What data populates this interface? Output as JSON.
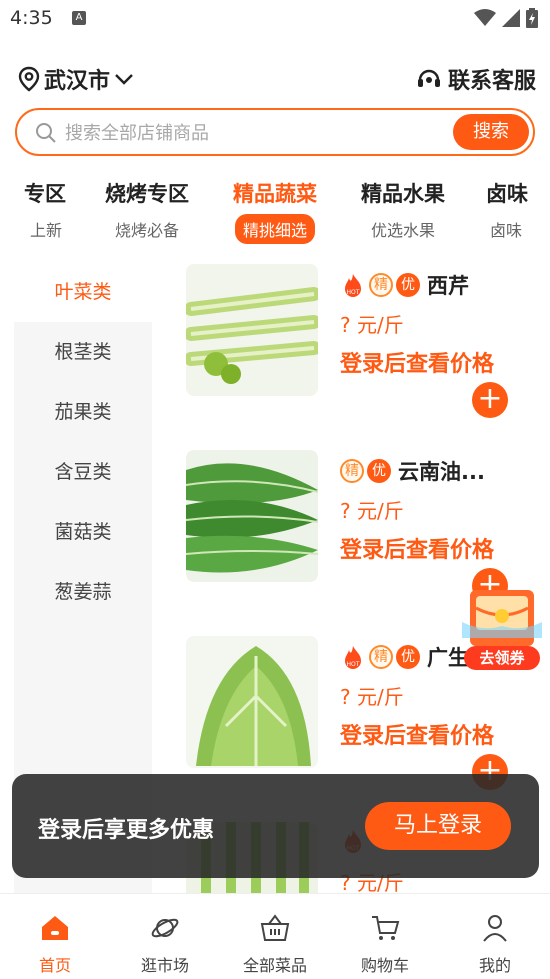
{
  "status_bar": {
    "time": "4:35",
    "notif_letter": "A"
  },
  "header": {
    "city": "武汉市",
    "service": "联系客服"
  },
  "search": {
    "placeholder": "搜索全部店铺商品",
    "button": "搜索"
  },
  "categories": [
    {
      "title": "专区",
      "sub": "上新"
    },
    {
      "title": "烧烤专区",
      "sub": "烧烤必备"
    },
    {
      "title": "精品蔬菜",
      "sub": "精挑细选"
    },
    {
      "title": "精品水果",
      "sub": "优选水果"
    },
    {
      "title": "卤味",
      "sub": "卤味"
    }
  ],
  "sidebar": [
    "叶菜类",
    "根茎类",
    "茄果类",
    "含豆类",
    "菌菇类",
    "葱姜蒜"
  ],
  "products": [
    {
      "name": "西芹",
      "price": "? 元/斤",
      "login": "登录后查看价格",
      "badges": {
        "hot": true,
        "jing": "精",
        "you": "优"
      }
    },
    {
      "name": "云南油...",
      "price": "? 元/斤",
      "login": "登录后查看价格",
      "badges": {
        "hot": false,
        "jing": "精",
        "you": "优"
      }
    },
    {
      "name": "广生",
      "price": "? 元/斤",
      "login": "登录后查看价格",
      "badges": {
        "hot": true,
        "jing": "精",
        "you": "优"
      }
    },
    {
      "name": "",
      "price": "? 元/斤",
      "login": "",
      "badges": {
        "hot": true,
        "jing": "",
        "you": ""
      }
    }
  ],
  "coupon": {
    "label": "去领券"
  },
  "login_banner": {
    "text": "登录后享更多优惠",
    "button": "马上登录"
  },
  "bottom_nav": [
    "首页",
    "逛市场",
    "全部菜品",
    "购物车",
    "我的"
  ],
  "colors": {
    "accent": "#ff5a14",
    "text": "#222222",
    "sidebar_bg": "#f6f6f6"
  }
}
